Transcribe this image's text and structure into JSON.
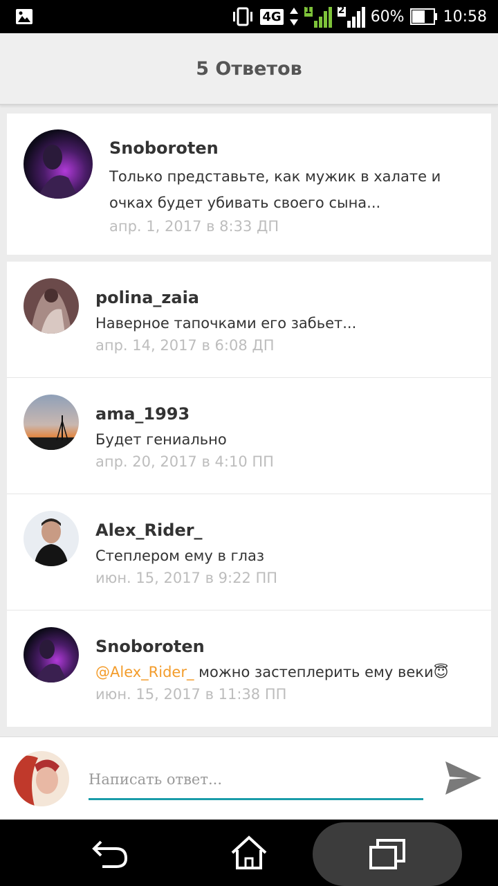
{
  "status_bar": {
    "network": "4G",
    "sim1": "1",
    "sim2": "2",
    "battery": "60%",
    "time": "10:58",
    "icons": [
      "gallery-icon",
      "vibrate-icon",
      "data-arrows-icon",
      "signal-icon",
      "battery-icon"
    ]
  },
  "header": {
    "title": "5 Ответов"
  },
  "main_comment": {
    "username": "Snoboroten",
    "text": "Только представьте, как мужик в халате и очках будет убивать своего сына...",
    "date": "апр. 1, 2017 в 8:33 ДП"
  },
  "replies": [
    {
      "username": "polina_zaia",
      "text": "Наверное тапочками его забьет...",
      "date": "апр. 14, 2017 в 6:08 ДП"
    },
    {
      "username": "ama_1993",
      "text": "Будет гениально",
      "date": "апр. 20, 2017 в 4:10 ПП"
    },
    {
      "username": "Alex_Rider_",
      "text": "Степлером ему в глаз",
      "date": "июн. 15, 2017 в 9:22 ПП"
    },
    {
      "username": "Snoboroten",
      "mention": "@Alex_Rider_",
      "text": " можно застеплерить ему веки",
      "emoji": "😇",
      "date": "июн. 15, 2017 в 11:38 ПП"
    }
  ],
  "reply_box": {
    "placeholder": "Написать ответ...",
    "value": ""
  },
  "nav_bar": {
    "icons": [
      "back-icon",
      "home-icon",
      "recents-icon"
    ]
  },
  "colors": {
    "accent": "#1a9ca9",
    "mention": "#f39c2b",
    "muted": "#bdbdbd"
  }
}
